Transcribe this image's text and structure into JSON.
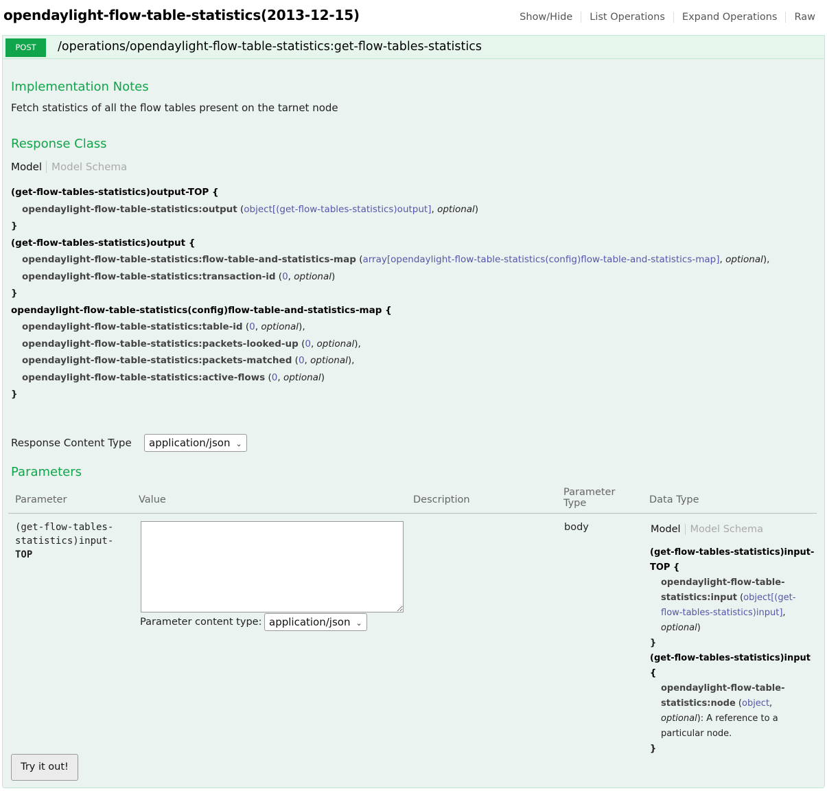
{
  "api": {
    "title": "opendaylight-flow-table-statistics(2013-12-15)",
    "links": [
      "Show/Hide",
      "List Operations",
      "Expand Operations",
      "Raw"
    ]
  },
  "operation": {
    "method": "POST",
    "path": "/operations/opendaylight-flow-table-statistics:get-flow-tables-statistics",
    "implementation_notes_title": "Implementation Notes",
    "implementation_notes": "Fetch statistics of all the flow tables present on the tarnet node",
    "response_class_title": "Response Class",
    "model_tab": "Model",
    "model_schema_tab": "Model Schema",
    "response_content_type_label": "Response Content Type",
    "response_content_type": "application/json",
    "parameters_title": "Parameters",
    "try_button": "Try it out!"
  },
  "response_model": {
    "cls1": "(get-flow-tables-statistics)output-TOP {",
    "p1_name": "opendaylight-flow-table-statistics:output",
    "p1_type": "object[(get-flow-tables-statistics)output]",
    "optional": "optional",
    "close": "}",
    "cls2": "(get-flow-tables-statistics)output {",
    "p2_name": "opendaylight-flow-table-statistics:flow-table-and-statistics-map",
    "p2_type": "array[opendaylight-flow-table-statistics(config)flow-table-and-statistics-map]",
    "p3_name": "opendaylight-flow-table-statistics:transaction-id",
    "zero": "0",
    "cls3": "opendaylight-flow-table-statistics(config)flow-table-and-statistics-map {",
    "p4_name": "opendaylight-flow-table-statistics:table-id",
    "p5_name": "opendaylight-flow-table-statistics:packets-looked-up",
    "p6_name": "opendaylight-flow-table-statistics:packets-matched",
    "p7_name": "opendaylight-flow-table-statistics:active-flows"
  },
  "params_table": {
    "headers": [
      "Parameter",
      "Value",
      "Description",
      "Parameter\nType",
      "Data Type"
    ],
    "header_param_type_line1": "Parameter",
    "header_param_type_line2": "Type",
    "row": {
      "name_line1": "(get-flow-tables-",
      "name_line2": "statistics)input-",
      "name_line3": "TOP",
      "value": "",
      "param_content_type_label": "Parameter content type:",
      "param_content_type": "application/json",
      "param_type": "body",
      "model_tab": "Model",
      "model_schema_tab": "Model Schema"
    }
  },
  "input_model": {
    "cls1_a": "(get-flow-tables-statistics)input-",
    "cls1_b": "TOP {",
    "p1_name_a": "opendaylight-flow-table-",
    "p1_name_b": "statistics:input",
    "p1_type_a": "object[(get-",
    "p1_type_b": "flow-tables-statistics)input]",
    "optional": "optional",
    "close": "}",
    "cls2": "(get-flow-tables-statistics)input {",
    "p2_name_a": "opendaylight-flow-table-",
    "p2_name_b": "statistics:node",
    "p2_type": "object",
    "p2_desc_a": ": A reference to a",
    "p2_desc_b": "particular node."
  }
}
